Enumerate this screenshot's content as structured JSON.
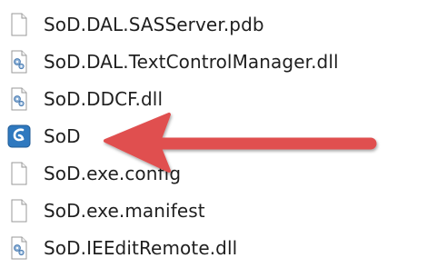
{
  "files": [
    {
      "name": "SoD.DAL.SASServer.pdb",
      "icon": "generic-file-icon"
    },
    {
      "name": "SoD.DAL.TextControlManager.dll",
      "icon": "dll-file-icon"
    },
    {
      "name": "SoD.DDCF.dll",
      "icon": "dll-file-icon"
    },
    {
      "name": "SoD",
      "icon": "sod-application-icon"
    },
    {
      "name": "SoD.exe.config",
      "icon": "generic-file-icon"
    },
    {
      "name": "SoD.exe.manifest",
      "icon": "generic-file-icon"
    },
    {
      "name": "SoD.IEEditRemote.dll",
      "icon": "dll-file-icon"
    }
  ],
  "app_icon_glyph": "S",
  "colors": {
    "arrow": "#e05050",
    "app_icon": "#2f79bf",
    "text": "#1f1f1f",
    "file_border": "#9a9a9a"
  }
}
